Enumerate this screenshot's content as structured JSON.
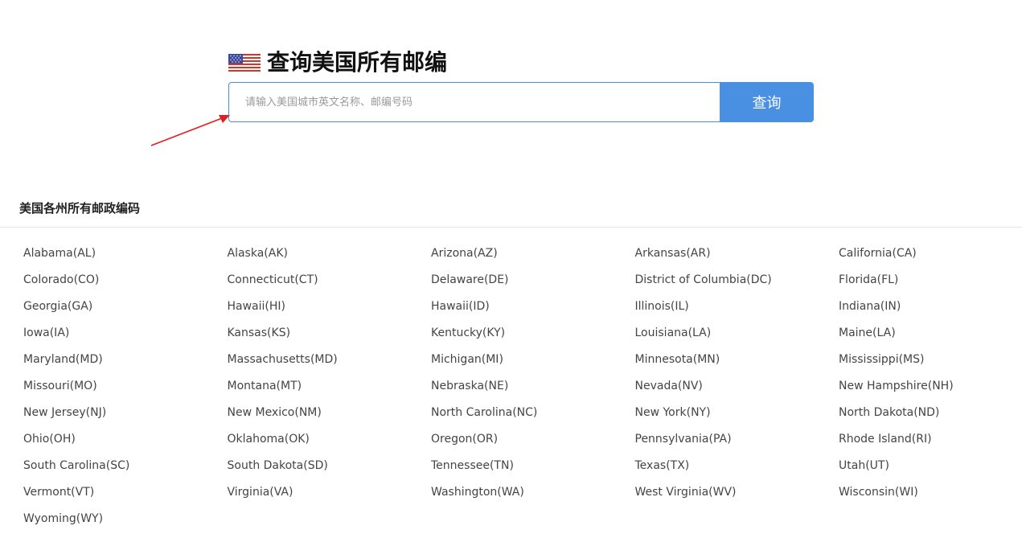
{
  "header": {
    "title": "查询美国所有邮编",
    "flag_icon": "us-flag-icon"
  },
  "search": {
    "placeholder": "请输入美国城市英文名称、邮编号码",
    "value": "",
    "button_label": "查询"
  },
  "annotation": {
    "arrow_color": "#e02020"
  },
  "colors": {
    "accent": "#4a90e2"
  },
  "section": {
    "title": "美国各州所有邮政编码"
  },
  "states": [
    "Alabama(AL)",
    "Alaska(AK)",
    "Arizona(AZ)",
    "Arkansas(AR)",
    "California(CA)",
    "Colorado(CO)",
    "Connecticut(CT)",
    "Delaware(DE)",
    "District of Columbia(DC)",
    "Florida(FL)",
    "Georgia(GA)",
    "Hawaii(HI)",
    "Hawaii(ID)",
    "Illinois(IL)",
    "Indiana(IN)",
    "Iowa(IA)",
    "Kansas(KS)",
    "Kentucky(KY)",
    "Louisiana(LA)",
    "Maine(LA)",
    "Maryland(MD)",
    "Massachusetts(MD)",
    "Michigan(MI)",
    "Minnesota(MN)",
    "Mississippi(MS)",
    "Missouri(MO)",
    "Montana(MT)",
    "Nebraska(NE)",
    "Nevada(NV)",
    "New Hampshire(NH)",
    "New Jersey(NJ)",
    "New Mexico(NM)",
    "North Carolina(NC)",
    "New York(NY)",
    "North Dakota(ND)",
    "Ohio(OH)",
    "Oklahoma(OK)",
    "Oregon(OR)",
    "Pennsylvania(PA)",
    "Rhode Island(RI)",
    "South Carolina(SC)",
    "South Dakota(SD)",
    "Tennessee(TN)",
    "Texas(TX)",
    "Utah(UT)",
    "Vermont(VT)",
    "Virginia(VA)",
    "Washington(WA)",
    "West Virginia(WV)",
    "Wisconsin(WI)",
    "Wyoming(WY)"
  ]
}
